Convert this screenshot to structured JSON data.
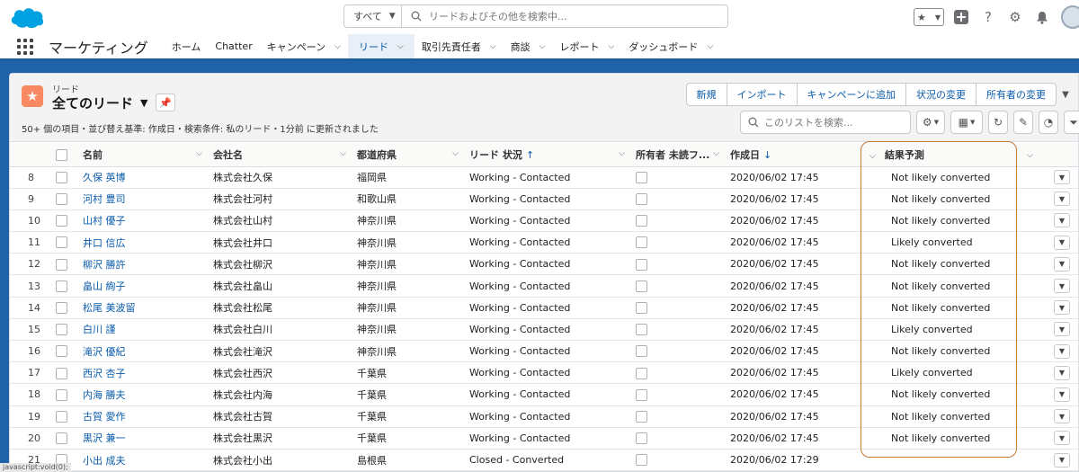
{
  "header": {
    "search_scope": "すべて",
    "search_placeholder": "リードおよびその他を検索中..."
  },
  "nav": {
    "app_name": "マーケティング",
    "items": [
      {
        "label": "ホーム",
        "chevron": false
      },
      {
        "label": "Chatter",
        "chevron": false
      },
      {
        "label": "キャンペーン",
        "chevron": true
      },
      {
        "label": "リード",
        "chevron": true,
        "active": true
      },
      {
        "label": "取引先責任者",
        "chevron": true
      },
      {
        "label": "商談",
        "chevron": true
      },
      {
        "label": "レポート",
        "chevron": true
      },
      {
        "label": "ダッシュボード",
        "chevron": true
      }
    ]
  },
  "list_view": {
    "object_label": "リード",
    "title": "全てのリード",
    "meta": "50+ 個の項目・並び替え基準: 作成日・検索条件: 私のリード・1分前 に更新されました",
    "buttons": [
      "新規",
      "インポート",
      "キャンペーンに追加",
      "状況の変更",
      "所有者の変更"
    ],
    "search_placeholder": "このリストを検索..."
  },
  "table": {
    "columns": {
      "name": "名前",
      "company": "会社名",
      "prefecture": "都道府県",
      "status": "リード 状況",
      "owner_unread": "所有者 未読フ...",
      "created": "作成日",
      "prediction": "結果予測"
    },
    "rows": [
      {
        "num": "8",
        "name": "久保 英博",
        "company": "株式会社久保",
        "prefecture": "福岡県",
        "status": "Working - Contacted",
        "created": "2020/06/02 17:45",
        "prediction": "Not likely converted"
      },
      {
        "num": "9",
        "name": "河村 豊司",
        "company": "株式会社河村",
        "prefecture": "和歌山県",
        "status": "Working - Contacted",
        "created": "2020/06/02 17:45",
        "prediction": "Not likely converted"
      },
      {
        "num": "10",
        "name": "山村 優子",
        "company": "株式会社山村",
        "prefecture": "神奈川県",
        "status": "Working - Contacted",
        "created": "2020/06/02 17:45",
        "prediction": "Not likely converted"
      },
      {
        "num": "11",
        "name": "井口 信広",
        "company": "株式会社井口",
        "prefecture": "神奈川県",
        "status": "Working - Contacted",
        "created": "2020/06/02 17:45",
        "prediction": "Likely converted"
      },
      {
        "num": "12",
        "name": "柳沢 勝許",
        "company": "株式会社柳沢",
        "prefecture": "神奈川県",
        "status": "Working - Contacted",
        "created": "2020/06/02 17:45",
        "prediction": "Not likely converted"
      },
      {
        "num": "13",
        "name": "畠山 絢子",
        "company": "株式会社畠山",
        "prefecture": "神奈川県",
        "status": "Working - Contacted",
        "created": "2020/06/02 17:45",
        "prediction": "Not likely converted"
      },
      {
        "num": "14",
        "name": "松尾 美波留",
        "company": "株式会社松尾",
        "prefecture": "神奈川県",
        "status": "Working - Contacted",
        "created": "2020/06/02 17:45",
        "prediction": "Not likely converted"
      },
      {
        "num": "15",
        "name": "白川 謹",
        "company": "株式会社白川",
        "prefecture": "神奈川県",
        "status": "Working - Contacted",
        "created": "2020/06/02 17:45",
        "prediction": "Likely converted"
      },
      {
        "num": "16",
        "name": "滝沢 優紀",
        "company": "株式会社滝沢",
        "prefecture": "神奈川県",
        "status": "Working - Contacted",
        "created": "2020/06/02 17:45",
        "prediction": "Not likely converted"
      },
      {
        "num": "17",
        "name": "西沢 杏子",
        "company": "株式会社西沢",
        "prefecture": "千葉県",
        "status": "Working - Contacted",
        "created": "2020/06/02 17:45",
        "prediction": "Likely converted"
      },
      {
        "num": "18",
        "name": "内海 勝夫",
        "company": "株式会社内海",
        "prefecture": "千葉県",
        "status": "Working - Contacted",
        "created": "2020/06/02 17:45",
        "prediction": "Not likely converted"
      },
      {
        "num": "19",
        "name": "古賀 愛作",
        "company": "株式会社古賀",
        "prefecture": "千葉県",
        "status": "Working - Contacted",
        "created": "2020/06/02 17:45",
        "prediction": "Not likely converted"
      },
      {
        "num": "20",
        "name": "黒沢 兼一",
        "company": "株式会社黒沢",
        "prefecture": "千葉県",
        "status": "Working - Contacted",
        "created": "2020/06/02 17:45",
        "prediction": "Not likely converted"
      },
      {
        "num": "21",
        "name": "小出 成夫",
        "company": "株式会社小出",
        "prefecture": "島根県",
        "status": "Closed - Converted",
        "created": "2020/06/02 17:29",
        "prediction": ""
      }
    ]
  },
  "status_bar": "javascript:void(0);",
  "colors": {
    "brand_blue": "#1e63a8",
    "link": "#0b5cab",
    "lead_icon": "#f88962",
    "highlight": "#c87a35"
  }
}
